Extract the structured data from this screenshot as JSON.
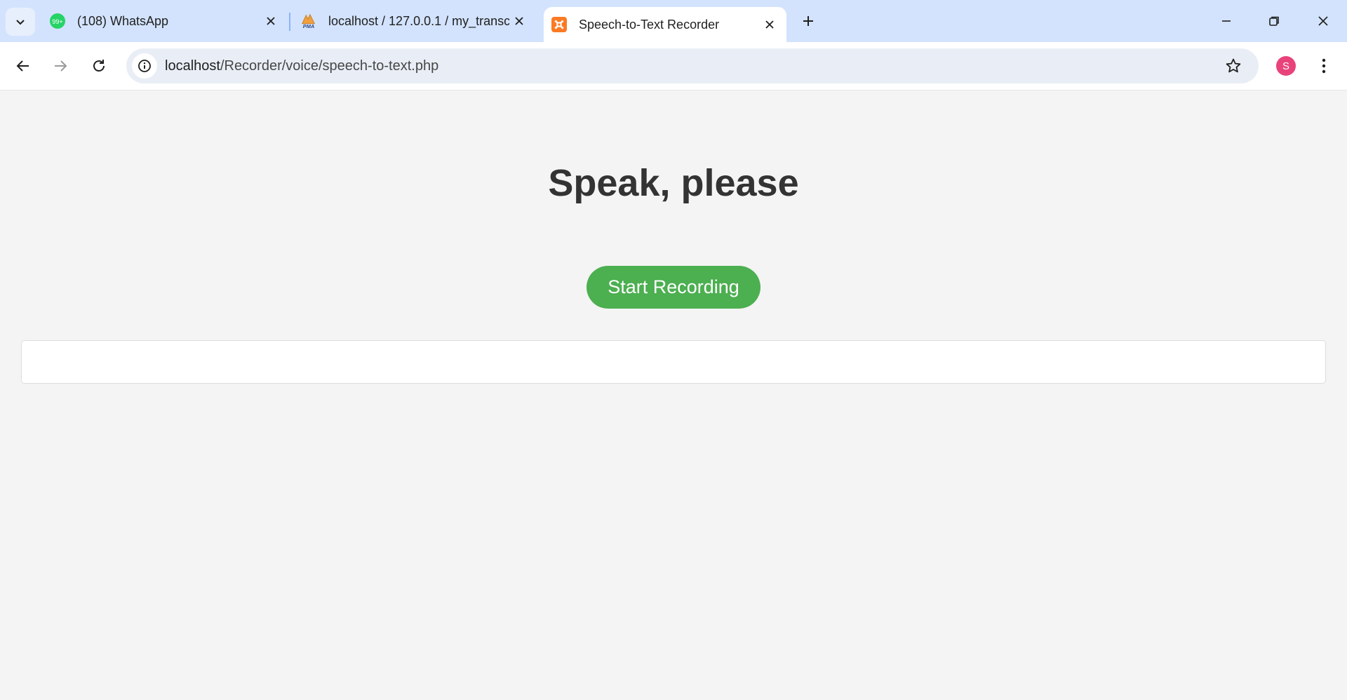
{
  "browser": {
    "tabs": [
      {
        "title": "(108) WhatsApp",
        "favicon": "whatsapp-icon",
        "badge": "99+",
        "active": false
      },
      {
        "title": "localhost / 127.0.0.1 / my_transc",
        "favicon": "phpmyadmin-icon",
        "favicon_text": "PMA",
        "active": false
      },
      {
        "title": "Speech-to-Text Recorder",
        "favicon": "xampp-icon",
        "active": true
      }
    ],
    "url_host": "localhost",
    "url_path": "/Recorder/voice/speech-to-text.php",
    "profile_initial": "S",
    "colors": {
      "tabstrip": "#d3e3fd",
      "omnibox": "#e9eef6",
      "avatar": "#e8437b"
    }
  },
  "page": {
    "heading": "Speak, please",
    "record_button_label": "Start Recording",
    "transcript": "",
    "colors": {
      "background": "#f4f4f4",
      "button": "#4caf50",
      "heading": "#333333"
    }
  }
}
